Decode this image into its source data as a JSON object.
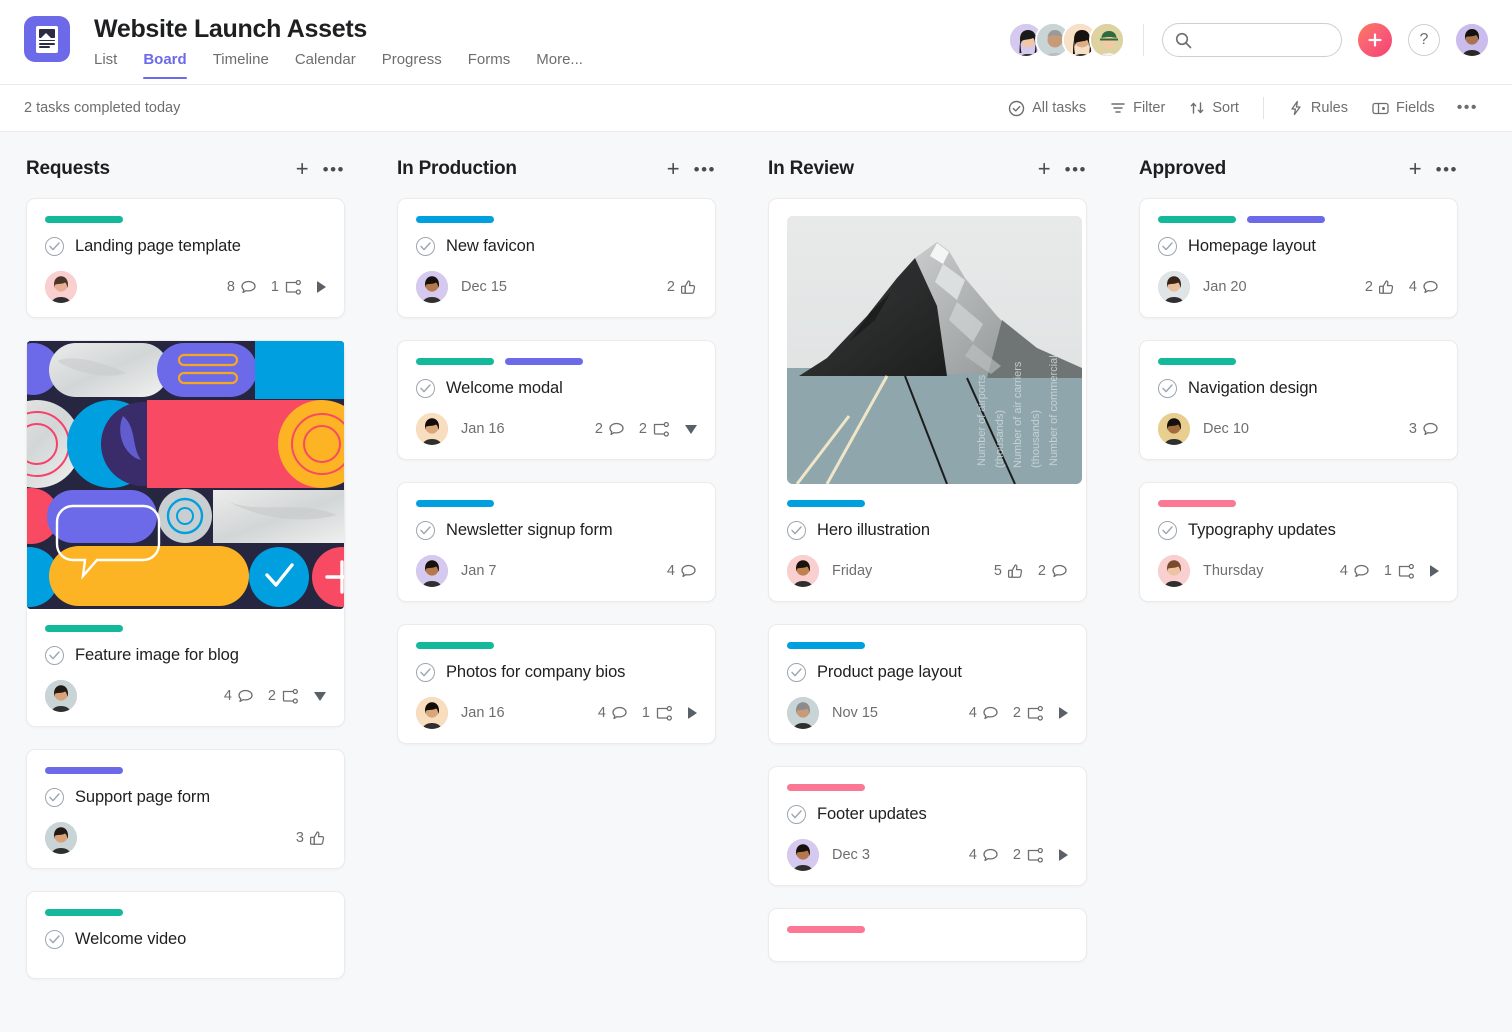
{
  "header": {
    "logo_icon": "document-image-icon",
    "title": "Website Launch Assets",
    "tabs": [
      {
        "label": "List",
        "active": false
      },
      {
        "label": "Board",
        "active": true
      },
      {
        "label": "Timeline",
        "active": false
      },
      {
        "label": "Calendar",
        "active": false
      },
      {
        "label": "Progress",
        "active": false
      },
      {
        "label": "Forms",
        "active": false
      },
      {
        "label": "More...",
        "active": false
      }
    ],
    "members": [
      {
        "name": "member-1",
        "skin": "#f0c7a8",
        "hair": "#1a1a1a",
        "bg": "#d6c9ef",
        "style": "long-dark"
      },
      {
        "name": "member-2",
        "skin": "#c79b77",
        "hair": "#9a9a9a",
        "bg": "#c9d4d6",
        "style": "short-grey"
      },
      {
        "name": "member-3",
        "skin": "#e0ae85",
        "hair": "#17120f",
        "bg": "#f7e0c6",
        "style": "long-black"
      },
      {
        "name": "member-4",
        "skin": "#f3c9a4",
        "hair": "#2f6b3c",
        "bg": "#ded3a0",
        "style": "cap"
      }
    ],
    "search": {
      "value": "",
      "placeholder": "",
      "icon": "search-icon"
    },
    "create_button": {
      "icon": "plus-icon",
      "accent": "#f5426c"
    },
    "help_button": {
      "label": "?",
      "icon": "question-mark-icon"
    },
    "me_avatar": {
      "name": "current-user-avatar",
      "skin": "#a87550",
      "hair": "#16110d",
      "bg": "#cbbcee"
    },
    "accent_color": "#6c6ae8"
  },
  "toolbar": {
    "status": "2 tasks completed today",
    "items": [
      {
        "label": "All tasks",
        "icon": "check-circle-icon"
      },
      {
        "label": "Filter",
        "icon": "filter-icon"
      },
      {
        "label": "Sort",
        "icon": "sort-arrows-icon"
      }
    ],
    "items2": [
      {
        "label": "Rules",
        "icon": "lightning-bolt-icon"
      },
      {
        "label": "Fields",
        "icon": "fields-rectangle-icon"
      }
    ],
    "overflow": "•••"
  },
  "tag_colors": {
    "green": "#14b89a",
    "blue": "#00a0e0",
    "purple": "#6c6ae8",
    "pink": "#fb7793"
  },
  "columns": [
    {
      "name": "requests",
      "title": "Requests",
      "add_icon": "plus-icon",
      "menu_icon": "more-dots-icon",
      "cards": [
        {
          "title": "Landing page template",
          "tags": [
            "green"
          ],
          "due": "",
          "assignee": {
            "skin": "#e8b093",
            "hair": "#4a3528",
            "bg": "#f9cfd0"
          },
          "meta": [
            {
              "type": "comments",
              "value": "8",
              "icon": "comment-icon"
            },
            {
              "type": "subtasks",
              "value": "1",
              "icon": "subtask-icon"
            }
          ],
          "expander": "right"
        },
        {
          "title": "Feature image for blog",
          "media": "abstract",
          "tags": [
            "green"
          ],
          "due": "",
          "assignee": {
            "skin": "#d9a279",
            "hair": "#241a14",
            "bg": "#c9d4d6"
          },
          "meta": [
            {
              "type": "comments",
              "value": "4",
              "icon": "comment-icon"
            },
            {
              "type": "subtasks",
              "value": "2",
              "icon": "subtask-icon"
            }
          ],
          "expander": "down"
        },
        {
          "title": "Support page form",
          "tags": [
            "purple"
          ],
          "due": "",
          "assignee": {
            "skin": "#d9a279",
            "hair": "#241a14",
            "bg": "#c9d4d6"
          },
          "meta": [
            {
              "type": "likes",
              "value": "3",
              "icon": "thumbs-up-icon"
            }
          ],
          "expander": ""
        },
        {
          "title": "Welcome video",
          "tags": [
            "green"
          ],
          "due": "",
          "partial": true,
          "assignee": null,
          "meta": [],
          "expander": ""
        }
      ]
    },
    {
      "name": "in-production",
      "title": "In Production",
      "add_icon": "plus-icon",
      "menu_icon": "more-dots-icon",
      "cards": [
        {
          "title": "New favicon",
          "tags": [
            "blue"
          ],
          "due": "Dec 15",
          "assignee": {
            "skin": "#b5784c",
            "hair": "#17110c",
            "bg": "#d6c9ef"
          },
          "meta": [
            {
              "type": "likes",
              "value": "2",
              "icon": "thumbs-up-icon"
            }
          ],
          "expander": ""
        },
        {
          "title": "Welcome modal",
          "tags": [
            "green",
            "purple"
          ],
          "due": "Jan 16",
          "assignee": {
            "skin": "#d9a87a",
            "hair": "#130d0a",
            "bg": "#f8ddbe"
          },
          "meta": [
            {
              "type": "comments",
              "value": "2",
              "icon": "comment-icon"
            },
            {
              "type": "subtasks",
              "value": "2",
              "icon": "subtask-icon"
            }
          ],
          "expander": "down"
        },
        {
          "title": "Newsletter signup form",
          "tags": [
            "blue"
          ],
          "due": "Jan 7",
          "assignee": {
            "skin": "#b5784c",
            "hair": "#17110c",
            "bg": "#d6c9ef"
          },
          "meta": [
            {
              "type": "comments",
              "value": "4",
              "icon": "comment-icon"
            }
          ],
          "expander": ""
        },
        {
          "title": "Photos for company bios",
          "tags": [
            "green"
          ],
          "due": "Jan 16",
          "assignee": {
            "skin": "#d9a87a",
            "hair": "#130d0a",
            "bg": "#f8ddbe"
          },
          "meta": [
            {
              "type": "comments",
              "value": "4",
              "icon": "comment-icon"
            },
            {
              "type": "subtasks",
              "value": "1",
              "icon": "subtask-icon"
            }
          ],
          "expander": "right"
        }
      ]
    },
    {
      "name": "in-review",
      "title": "In Review",
      "add_icon": "plus-icon",
      "menu_icon": "more-dots-icon",
      "cards": [
        {
          "title": "Hero illustration",
          "media": "photo",
          "tags": [
            "blue"
          ],
          "due": "Friday",
          "assignee": {
            "skin": "#c08050",
            "hair": "#1a130d",
            "bg": "#f9cfd0"
          },
          "meta": [
            {
              "type": "likes",
              "value": "5",
              "icon": "thumbs-up-icon"
            },
            {
              "type": "comments",
              "value": "2",
              "icon": "comment-icon"
            }
          ],
          "expander": ""
        },
        {
          "title": "Product page layout",
          "tags": [
            "blue"
          ],
          "due": "Nov 15",
          "assignee": {
            "skin": "#c79b77",
            "hair": "#8c8c8c",
            "bg": "#c9d4d6"
          },
          "meta": [
            {
              "type": "comments",
              "value": "4",
              "icon": "comment-icon"
            },
            {
              "type": "subtasks",
              "value": "2",
              "icon": "subtask-icon"
            }
          ],
          "expander": "right"
        },
        {
          "title": "Footer updates",
          "tags": [
            "pink"
          ],
          "due": "Dec 3",
          "assignee": {
            "skin": "#b5784c",
            "hair": "#17110c",
            "bg": "#d6c9ef"
          },
          "meta": [
            {
              "type": "comments",
              "value": "4",
              "icon": "comment-icon"
            },
            {
              "type": "subtasks",
              "value": "2",
              "icon": "subtask-icon"
            }
          ],
          "expander": "right"
        },
        {
          "title": "",
          "tags": [
            "pink"
          ],
          "due": "",
          "partial": true,
          "assignee": null,
          "meta": [],
          "expander": ""
        }
      ]
    },
    {
      "name": "approved",
      "title": "Approved",
      "add_icon": "plus-icon",
      "menu_icon": "more-dots-icon",
      "cards": [
        {
          "title": "Homepage layout",
          "tags": [
            "green",
            "purple"
          ],
          "due": "Jan 20",
          "assignee": {
            "skin": "#e8c0a0",
            "hair": "#3a2419",
            "bg": "#dfe4e6"
          },
          "meta": [
            {
              "type": "likes",
              "value": "2",
              "icon": "thumbs-up-icon"
            },
            {
              "type": "comments",
              "value": "4",
              "icon": "comment-icon"
            }
          ],
          "expander": ""
        },
        {
          "title": "Navigation design",
          "tags": [
            "green"
          ],
          "due": "Dec 10",
          "assignee": {
            "skin": "#a36c3f",
            "hair": "#14100c",
            "bg": "#e8cf8f"
          },
          "meta": [
            {
              "type": "comments",
              "value": "3",
              "icon": "comment-icon"
            }
          ],
          "expander": ""
        },
        {
          "title": "Typography updates",
          "tags": [
            "pink"
          ],
          "due": "Thursday",
          "assignee": {
            "skin": "#edc3a3",
            "hair": "#7a4a2c",
            "bg": "#f9cfd0"
          },
          "meta": [
            {
              "type": "comments",
              "value": "4",
              "icon": "comment-icon"
            },
            {
              "type": "subtasks",
              "value": "1",
              "icon": "subtask-icon"
            }
          ],
          "expander": "right"
        }
      ]
    }
  ]
}
